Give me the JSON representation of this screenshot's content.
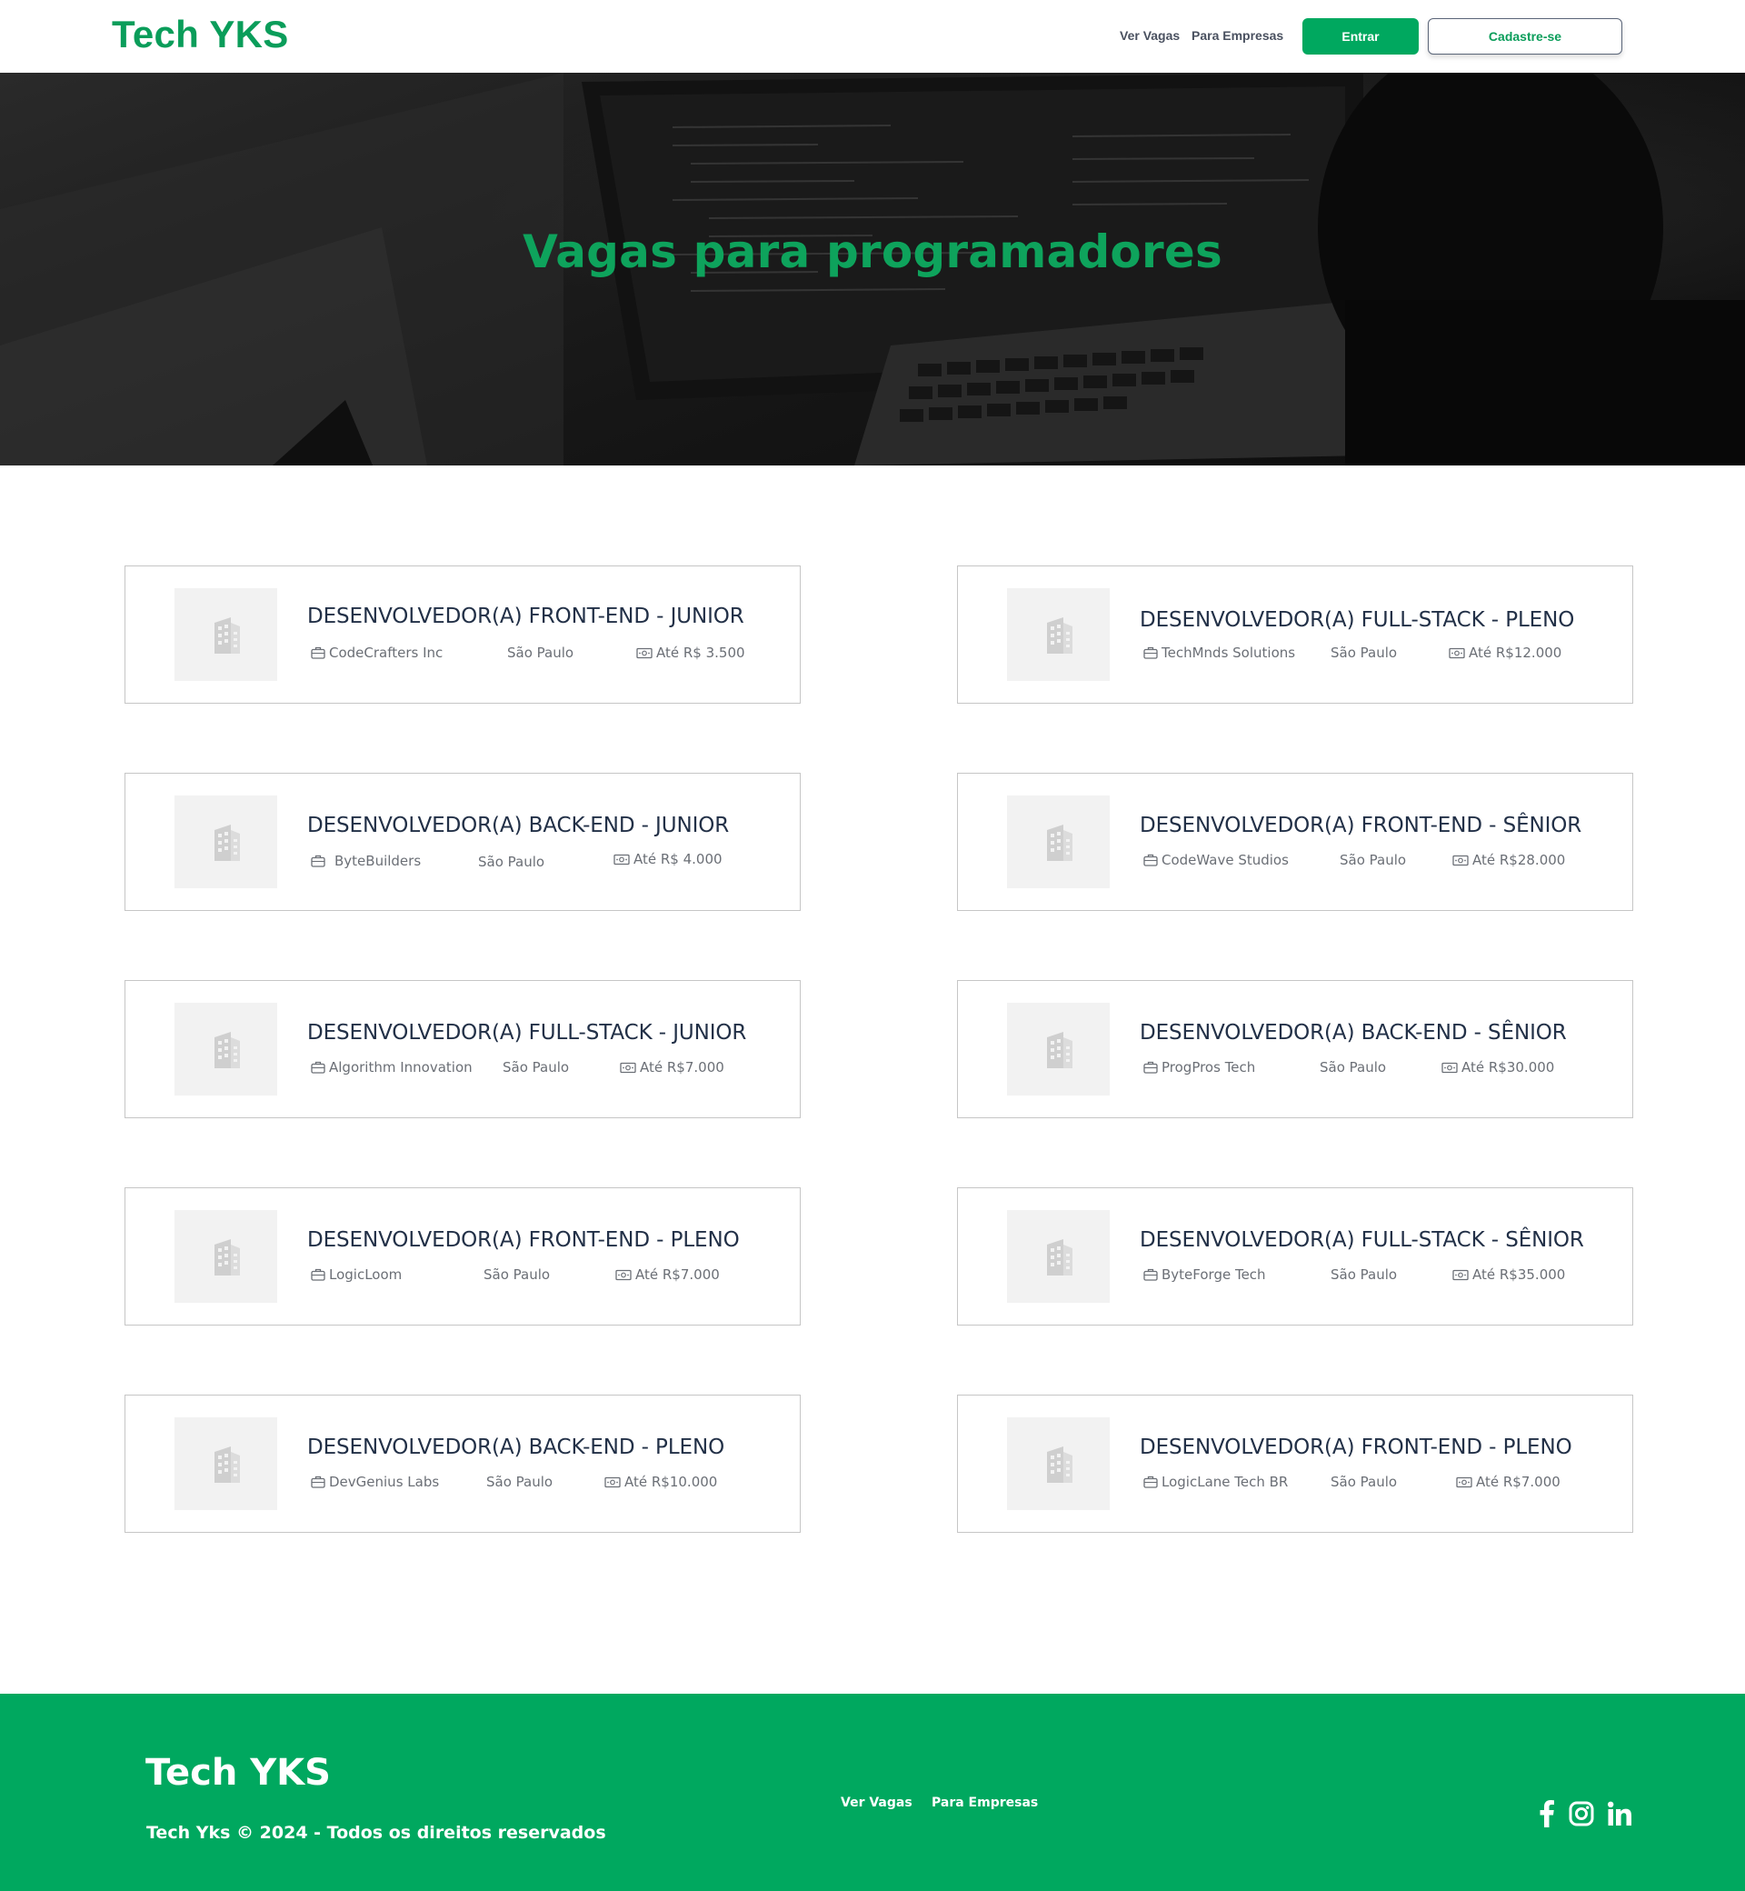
{
  "header": {
    "logo": "Tech YKS",
    "nav": [
      {
        "label": "Ver Vagas"
      },
      {
        "label": "Para Empresas"
      }
    ],
    "login_label": "Entrar",
    "signup_label": "Cadastre-se"
  },
  "hero": {
    "title": "Vagas para programadores"
  },
  "jobs": [
    {
      "title": "DESENVOLVEDOR(A) FRONT-END - JUNIOR",
      "company": "CodeCrafters Inc",
      "city": "São Paulo",
      "salary": "Até R$ 3.500"
    },
    {
      "title": "DESENVOLVEDOR(A) FULL-STACK - PLENO",
      "company": "TechMnds Solutions",
      "city": "São Paulo",
      "salary": "Até R$12.000"
    },
    {
      "title": "DESENVOLVEDOR(A) BACK-END - JUNIOR",
      "company": "ByteBuilders",
      "city": "São Paulo",
      "salary": "Até R$ 4.000"
    },
    {
      "title": "DESENVOLVEDOR(A) FRONT-END - SÊNIOR",
      "company": "CodeWave Studios",
      "city": "São Paulo",
      "salary": "Até R$28.000"
    },
    {
      "title": "DESENVOLVEDOR(A) FULL-STACK - JUNIOR",
      "company": "Algorithm Innovation",
      "city": "São Paulo",
      "salary": "Até R$7.000"
    },
    {
      "title": "DESENVOLVEDOR(A) BACK-END - SÊNIOR",
      "company": "ProgPros Tech",
      "city": "São Paulo",
      "salary": "Até R$30.000"
    },
    {
      "title": "DESENVOLVEDOR(A) FRONT-END - PLENO",
      "company": "LogicLoom",
      "city": "São Paulo",
      "salary": "Até R$7.000"
    },
    {
      "title": "DESENVOLVEDOR(A) FULL-STACK - SÊNIOR",
      "company": "ByteForge Tech",
      "city": "São Paulo",
      "salary": "Até R$35.000"
    },
    {
      "title": "DESENVOLVEDOR(A) BACK-END - PLENO",
      "company": "DevGenius Labs",
      "city": "São Paulo",
      "salary": "Até R$10.000"
    },
    {
      "title": "DESENVOLVEDOR(A) FRONT-END - PLENO",
      "company": "LogicLane Tech BR",
      "city": "São Paulo",
      "salary": "Até R$7.000"
    }
  ],
  "icons": {
    "company": "building-icon",
    "employer": "briefcase-icon",
    "salary": "money-icon",
    "social": [
      "facebook-icon",
      "instagram-icon",
      "linkedin-icon"
    ]
  },
  "footer": {
    "logo": "Tech YKS",
    "copyright": "Tech Yks © 2024 - Todos os direitos reservados",
    "links": [
      {
        "label": "Ver Vagas"
      },
      {
        "label": "Para Empresas"
      }
    ]
  },
  "colors": {
    "brand_green": "#00a85f",
    "text_dark": "#223047",
    "text_muted": "#6b6f76",
    "card_border": "#c6c6c6"
  }
}
